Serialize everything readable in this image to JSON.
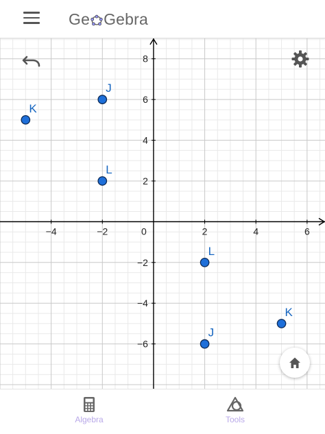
{
  "app": {
    "name_left": "Ge",
    "name_right": "Gebra",
    "icons": {
      "menu": "hamburger-menu-icon",
      "undo": "undo-icon",
      "settings": "gear-icon",
      "home": "home-icon"
    }
  },
  "colors": {
    "point_fill": "#1e6fd9",
    "point_label": "#1565c0",
    "axis": "#000000",
    "grid_major": "#c8c8c8",
    "grid_minor": "#e9e9e9",
    "tab_label": "#b8a8e8"
  },
  "chart_data": {
    "type": "scatter",
    "xlim": [
      -6,
      6.7
    ],
    "ylim": [
      -8.2,
      9
    ],
    "grid": true,
    "x_ticks": [
      -4,
      -2,
      0,
      2,
      4,
      6
    ],
    "y_ticks": [
      8,
      6,
      4,
      2,
      -2,
      -4,
      -6
    ],
    "x_tick_labels": [
      "−4",
      "−2",
      "0",
      "2",
      "4",
      "6"
    ],
    "y_tick_labels": [
      "8",
      "6",
      "4",
      "2",
      "−2",
      "−4",
      "−6"
    ],
    "points": [
      {
        "label": "K",
        "x": -5,
        "y": 5
      },
      {
        "label": "J",
        "x": -2,
        "y": 6
      },
      {
        "label": "L",
        "x": -2,
        "y": 2
      },
      {
        "label": "L",
        "x": 2,
        "y": -2
      },
      {
        "label": "J",
        "x": 2,
        "y": -6
      },
      {
        "label": "K",
        "x": 5,
        "y": -5
      }
    ]
  },
  "bottom_nav": {
    "algebra": {
      "label": "Algebra",
      "icon": "calculator-icon"
    },
    "tools": {
      "label": "Tools",
      "icon": "tools-shapes-icon"
    }
  }
}
